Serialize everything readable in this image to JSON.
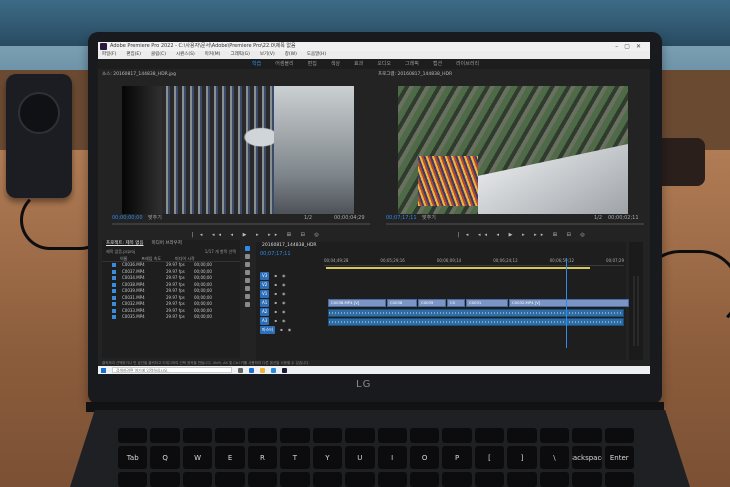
{
  "window": {
    "title": "Adobe Premiere Pro 2022 - C:\\사용자\\문서\\Adobe\\Premiere Pro\\22.0\\제목 없음"
  },
  "menu": [
    "파일(F)",
    "편집(E)",
    "클립(C)",
    "시퀀스(S)",
    "마커(M)",
    "그래픽(G)",
    "보기(V)",
    "창(W)",
    "도움말(H)"
  ],
  "workspaces": [
    {
      "label": "학습",
      "active": true
    },
    {
      "label": "어셈블리",
      "active": false
    },
    {
      "label": "편집",
      "active": false
    },
    {
      "label": "색상",
      "active": false
    },
    {
      "label": "효과",
      "active": false
    },
    {
      "label": "오디오",
      "active": false
    },
    {
      "label": "그래픽",
      "active": false
    },
    {
      "label": "캡션",
      "active": false
    },
    {
      "label": "라이브러리",
      "active": false
    }
  ],
  "source_monitor": {
    "label": "소스: 20160817_144838_HDR.jpg",
    "timecode_in": "00;00;00;00",
    "fit": "맞추기",
    "ratio": "1/2",
    "timecode_out": "00;00;04;29"
  },
  "program_monitor": {
    "label": "프로그램: 20160817_144838_HDR",
    "timecode_in": "00;07;17;11",
    "fit": "맞추기",
    "ratio": "1/2",
    "timecode_out": "00;00;02;11"
  },
  "project_panel": {
    "tabs": [
      {
        "label": "프로젝트: 제목 없음",
        "active": true
      },
      {
        "label": "미디어 브라우저",
        "active": false
      }
    ],
    "file": "제목 없음.prproj",
    "count": "1/17 개 항목 선택",
    "columns": [
      "이름",
      "프레임 속도",
      "미디어 시작"
    ],
    "clips": [
      {
        "name": "C0036.MP4",
        "rate": "29.97 fps",
        "start": "00;00;00"
      },
      {
        "name": "C0037.MP4",
        "rate": "29.97 fps",
        "start": "00;00;00"
      },
      {
        "name": "C0034.MP4",
        "rate": "29.97 fps",
        "start": "00;00;00"
      },
      {
        "name": "C0038.MP4",
        "rate": "29.97 fps",
        "start": "00;00;00"
      },
      {
        "name": "C0039.MP4",
        "rate": "29.97 fps",
        "start": "00;00;00"
      },
      {
        "name": "C0031.MP4",
        "rate": "29.97 fps",
        "start": "00;00;00"
      },
      {
        "name": "C0032.MP4",
        "rate": "29.97 fps",
        "start": "00;00;00"
      },
      {
        "name": "C0033.MP4",
        "rate": "29.97 fps",
        "start": "00;00;00"
      },
      {
        "name": "C0035.MP4",
        "rate": "29.97 fps",
        "start": "00;00;00"
      }
    ]
  },
  "timeline": {
    "tab": "20160817_144838_HDR",
    "timecode": "00;07;17;11",
    "ruler": [
      "00;04;49;28",
      "00;05;29;16",
      "00;06;09;14",
      "00;06;24;12",
      "00;06;59;12",
      "00;07;29"
    ],
    "tracks": [
      "V3",
      "V2",
      "V1",
      "A1",
      "A2",
      "A3",
      "마스터"
    ],
    "video_clips": [
      "C0038.MP4 [V]",
      "C0038",
      "C0039",
      "C0",
      "C0031",
      "C0032.MP4 [V]"
    ]
  },
  "status": "클릭하여 선택하거나 빈 공간을 클릭하고 드래그하여 선택 윤곽을 만듭니다. Shift, Alt 및 Ctrl 키를 사용하여 다른 옵션을 사용할 수 있습니다.",
  "taskbar": {
    "search_placeholder": "검색하려면 여기에 입력하십시오."
  },
  "laptop": {
    "brand": "LG"
  },
  "keyboard": {
    "keys": [
      "Tab",
      "Q",
      "W",
      "E",
      "R",
      "T",
      "Y",
      "U",
      "I",
      "O",
      "P",
      "[",
      "]",
      "\\",
      "Backspace",
      "Enter"
    ]
  }
}
